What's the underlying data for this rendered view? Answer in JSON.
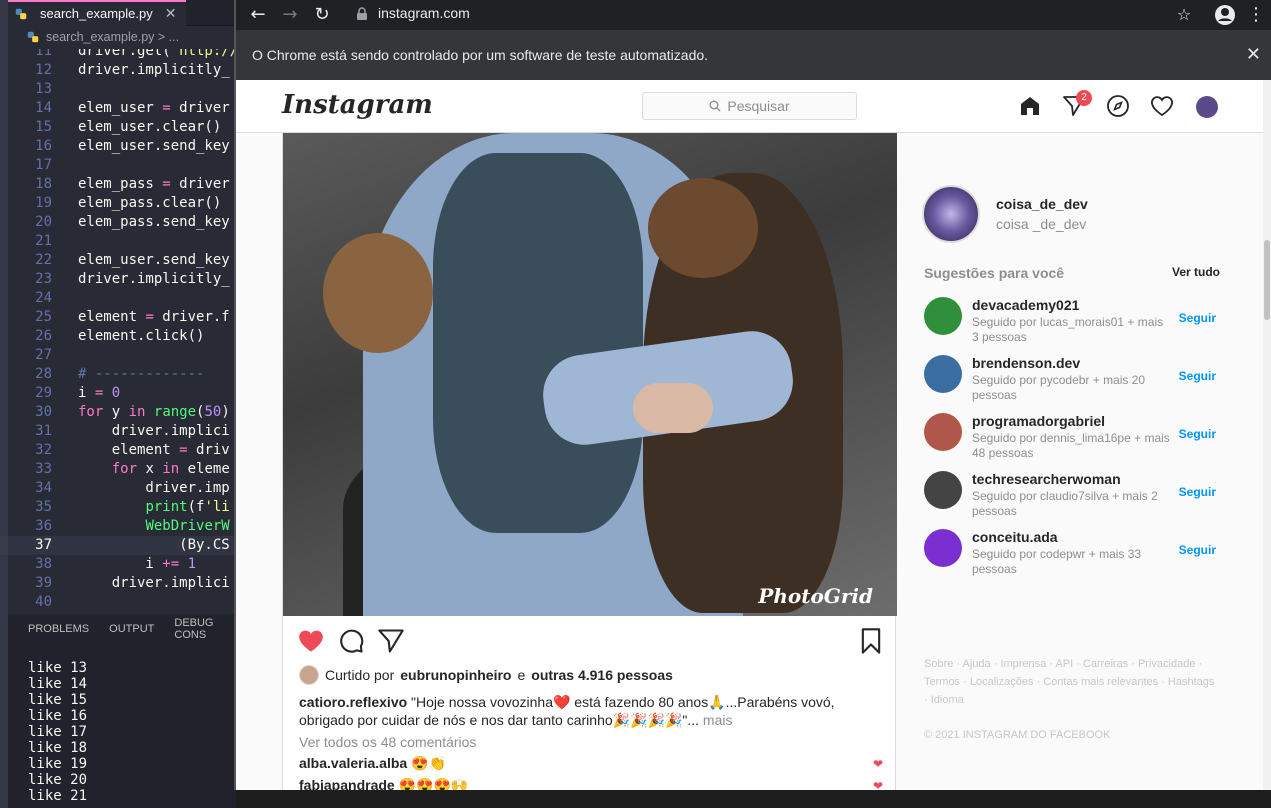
{
  "vscode": {
    "tab_label": "search_example.py",
    "breadcrumb": "search_example.py > ...",
    "lines": [
      {
        "no": "11",
        "html": "<span class=\"txt\">driver.get(<span class=\"s\">'http://</span></span>"
      },
      {
        "no": "12",
        "html": "<span class=\"txt\">driver.implicitly_</span>"
      },
      {
        "no": "13",
        "html": ""
      },
      {
        "no": "14",
        "html": "<span class=\"txt\">elem_user <span class=\"k\">=</span> driver</span>"
      },
      {
        "no": "15",
        "html": "<span class=\"txt\">elem_user.clear()</span>"
      },
      {
        "no": "16",
        "html": "<span class=\"txt\">elem_user.send_key</span>"
      },
      {
        "no": "17",
        "html": ""
      },
      {
        "no": "18",
        "html": "<span class=\"txt\">elem_pass <span class=\"k\">=</span> driver</span>"
      },
      {
        "no": "19",
        "html": "<span class=\"txt\">elem_pass.clear()</span>"
      },
      {
        "no": "20",
        "html": "<span class=\"txt\">elem_pass.send_key</span>"
      },
      {
        "no": "21",
        "html": ""
      },
      {
        "no": "22",
        "html": "<span class=\"txt\">elem_user.send_key</span>"
      },
      {
        "no": "23",
        "html": "<span class=\"txt\">driver.implicitly_</span>"
      },
      {
        "no": "24",
        "html": ""
      },
      {
        "no": "25",
        "html": "<span class=\"txt\">element <span class=\"k\">=</span> driver.f</span>"
      },
      {
        "no": "26",
        "html": "<span class=\"txt\">element.click()</span>"
      },
      {
        "no": "27",
        "html": ""
      },
      {
        "no": "28",
        "html": "<span class=\"txt c\"># -------------</span>"
      },
      {
        "no": "29",
        "html": "<span class=\"txt\">i <span class=\"k\">=</span> <span class=\"n\">0</span></span>"
      },
      {
        "no": "30",
        "html": "<span class=\"txt\"><span class=\"k\">for</span> y <span class=\"k\">in</span> <span class=\"e\">range</span>(<span class=\"n\">50</span>)</span>"
      },
      {
        "no": "31",
        "html": "<span class=\"txt\">    driver.implici</span>"
      },
      {
        "no": "32",
        "html": "<span class=\"txt\">    element <span class=\"k\">=</span> driv</span>"
      },
      {
        "no": "33",
        "html": "<span class=\"txt\">    <span class=\"k\">for</span> x <span class=\"k\">in</span> eleme</span>"
      },
      {
        "no": "34",
        "html": "<span class=\"txt\">        driver.imp</span>"
      },
      {
        "no": "35",
        "html": "<span class=\"txt\">        <span class=\"e\">print</span>(f<span class=\"s\">'li</span></span>"
      },
      {
        "no": "36",
        "html": "<span class=\"txt\">        <span class=\"e\">WebDriverW</span></span>"
      },
      {
        "no": "37",
        "html": "<span class=\"txt\">            (By.CS</span>"
      },
      {
        "no": "38",
        "html": "<span class=\"txt\">        i <span class=\"k\">+=</span> <span class=\"n\">1</span></span>"
      },
      {
        "no": "39",
        "html": "<span class=\"txt\">    driver.implici</span>"
      },
      {
        "no": "40",
        "html": ""
      }
    ],
    "panel_tabs": [
      "PROBLEMS",
      "OUTPUT",
      "DEBUG CONS"
    ],
    "output": [
      "like 13",
      "like 14",
      "like 15",
      "like 16",
      "like 17",
      "like 18",
      "like 19",
      "like 20",
      "like 21"
    ]
  },
  "chrome": {
    "url": "instagram.com",
    "infobar": "O Chrome está sendo controlado por um software de teste automatizado."
  },
  "ig": {
    "logo": "Instagram",
    "search_placeholder": "Pesquisar",
    "badge": "2",
    "post": {
      "watermark": "PhotoGrid",
      "liked_prefix": "Curtido por",
      "liked_user": "eubrunopinheiro",
      "liked_and": "e",
      "liked_others": "outras 4.916 pessoas",
      "caption_user": "catioro.reflexivo",
      "caption_text": "\"Hoje nossa vovozinha❤️ está fazendo 80 anos🙏...Parabéns vovó, obrigado por cuidar de nós e nos dar tanto carinho🎉🎉🎉🎉\"...",
      "caption_more": "mais",
      "view_comments": "Ver todos os 48 comentários",
      "comments": [
        {
          "user": "alba.valeria.alba",
          "text": "😍👏"
        },
        {
          "user": "fabiapandrade",
          "text": "😍😍😍🙌"
        }
      ]
    },
    "sidebar": {
      "username": "coisa_de_dev",
      "fullname": "coisa _de_dev",
      "suggestions_title": "Sugestões para você",
      "see_all": "Ver tudo",
      "follow_label": "Seguir",
      "suggestions": [
        {
          "user": "devacademy021",
          "desc": "Seguido por lucas_morais01 + mais 3 pessoas",
          "color": "#2f8f3a"
        },
        {
          "user": "brendenson.dev",
          "desc": "Seguido por pycodebr + mais 20 pessoas",
          "color": "#3a6ea0"
        },
        {
          "user": "programadorgabriel",
          "desc": "Seguido por dennis_lima16pe + mais 48 pessoas",
          "color": "#b0564a"
        },
        {
          "user": "techresearcherwoman",
          "desc": "Seguido por claudio7silva + mais 2 pessoas",
          "color": "#444444"
        },
        {
          "user": "conceitu.ada",
          "desc": "Seguido por codepwr + mais 33 pessoas",
          "color": "#7b2fd0"
        }
      ],
      "footer": "Sobre · Ajuda · Imprensa · API · Carreiras · Privacidade · Termos · Localizações · Contas mais relevantes · Hashtags · Idioma",
      "copyright": "© 2021 INSTAGRAM DO FACEBOOK"
    }
  }
}
